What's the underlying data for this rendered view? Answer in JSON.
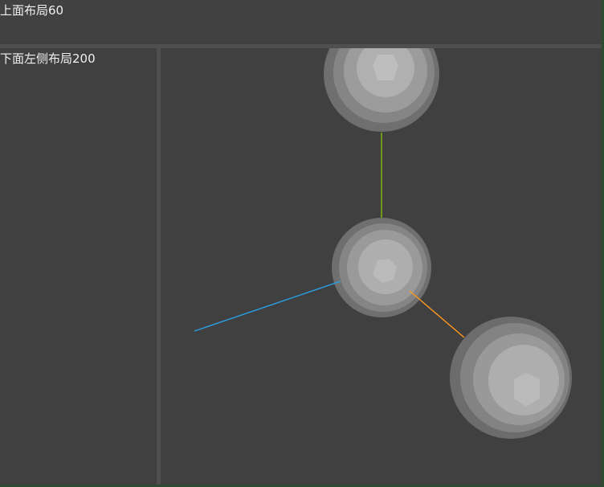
{
  "top_panel": {
    "label": "上面布局60"
  },
  "left_panel": {
    "label": "下面左侧布局200"
  },
  "viewport": {
    "axis_colors": {
      "x": "#2aa1e6",
      "y": "#8fd400",
      "z": "#ff9a1f"
    },
    "sphere_colors": [
      "#6d6d6d",
      "#828282",
      "#9a9a9a",
      "#b0b0b0"
    ]
  }
}
